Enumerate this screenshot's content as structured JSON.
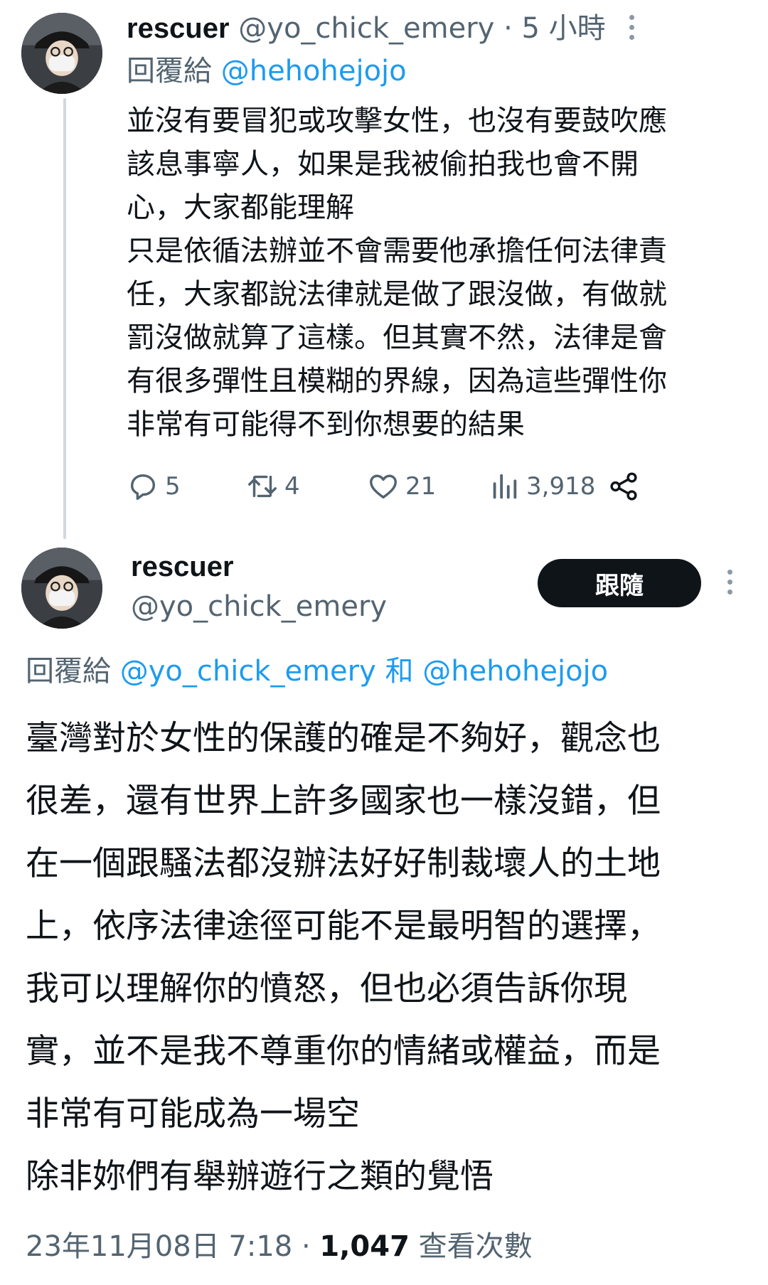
{
  "tweet1": {
    "display_name": "rescuer",
    "handle": "@yo_chick_emery",
    "separator": "·",
    "time": "5 小時",
    "reply_prefix": "回覆給",
    "reply_to": "@hehohejojo",
    "body_lines": [
      "並沒有要冒犯或攻擊女性，也沒有要鼓吹應",
      "該息事寧人，如果是我被偷拍我也會不開",
      "心，大家都能理解",
      "只是依循法辦並不會需要他承擔任何法律責",
      "任，大家都說法律就是做了跟沒做，有做就",
      "罰沒做就算了這樣。但其實不然，法律是會",
      "有很多彈性且模糊的界線，因為這些彈性你",
      "非常有可能得不到你想要的結果"
    ],
    "stats": {
      "replies": "5",
      "retweets": "4",
      "likes": "21",
      "views": "3,918"
    },
    "icons": [
      "reply-icon",
      "retweet-icon",
      "like-icon",
      "views-icon",
      "share-icon",
      "more-icon"
    ]
  },
  "tweet2": {
    "display_name": "rescuer",
    "handle": "@yo_chick_emery",
    "follow_label": "跟隨",
    "reply_prefix": "回覆給",
    "reply_to_1": "@yo_chick_emery",
    "reply_and": "和",
    "reply_to_2": "@hehohejojo",
    "body_lines": [
      "臺灣對於女性的保護的確是不夠好，觀念也",
      "很差，還有世界上許多國家也一樣沒錯，但",
      "在一個跟騷法都沒辦法好好制裁壞人的土地",
      "上，依序法律途徑可能不是最明智的選擇，",
      "我可以理解你的憤怒，但也必須告訴你現",
      "實，並不是我不尊重你的情緒或權益，而是",
      "非常有可能成為一場空",
      "除非妳們有舉辦遊行之類的覺悟"
    ],
    "date": "23年11月08日 7:18",
    "separator": "·",
    "view_count": "1,047",
    "view_label": "查看次數"
  },
  "colors": {
    "text": "#0f1419",
    "muted": "#536471",
    "link": "#1d9bf0",
    "button_bg": "#0f1419",
    "thread_line": "#cfd9de"
  }
}
